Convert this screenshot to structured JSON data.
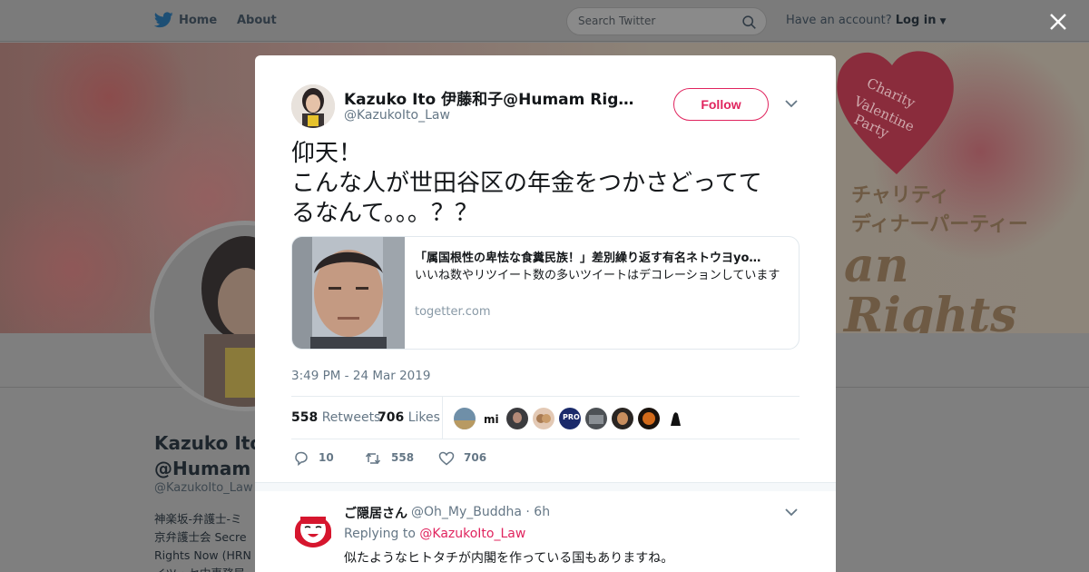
{
  "nav": {
    "home_label": "Home",
    "about_label": "About",
    "search_placeholder": "Search Twitter",
    "account_prompt": "Have an account?",
    "login_label": "Log in",
    "brand_color": "#1da1f2"
  },
  "background_profile": {
    "banner_text": {
      "charity": "Charity",
      "valentine": "Valentine",
      "party": "Party",
      "jp_line1": "チャリティ",
      "jp_line2": "ディナーパーティー",
      "big1": "an",
      "big2": "Rights"
    },
    "name_line1": "Kazuko Ito",
    "name_line2": "@Humam R",
    "handle": "@KazukoIto_Law",
    "bio_lines": [
      "神楽坂-弁護士-ミ",
      "京弁護士会 Secre",
      "Rights Now (HRN",
      "イツ・セ中事務局"
    ]
  },
  "tweet": {
    "author_name": "Kazuko Ito 伊藤和子@Humam Righ…",
    "author_handle": "@KazukoIto_Law",
    "follow_label": "Follow",
    "text_lines": [
      "仰天！",
      "こんな人が世田谷区の年金をつかさどってて",
      "るなんて。。。？？"
    ],
    "card": {
      "title": "「属国根性の卑怯な食糞民族！」差別繰り返す有名ネトウヨyo…",
      "description": "いいね数やリツイート数の多いツイートはデコレーションしています",
      "domain": "togetter.com"
    },
    "timestamp": "3:49 PM - 24 Mar 2019",
    "retweets_count": "558",
    "retweets_label": "Retweets",
    "likes_count": "706",
    "likes_label": "Likes",
    "actions": {
      "reply_count": "10",
      "retweet_count": "558",
      "like_count": "706"
    },
    "accent_color": "#e0245e"
  },
  "reply": {
    "name": "ご隠居さん",
    "handle": "@Oh_My_Buddha · 6h",
    "replying_to_prefix": "Replying to",
    "replying_to_mention": "@KazukoIto_Law",
    "text": "似たようなヒトタチが内閣を作っている国もありますね。"
  }
}
